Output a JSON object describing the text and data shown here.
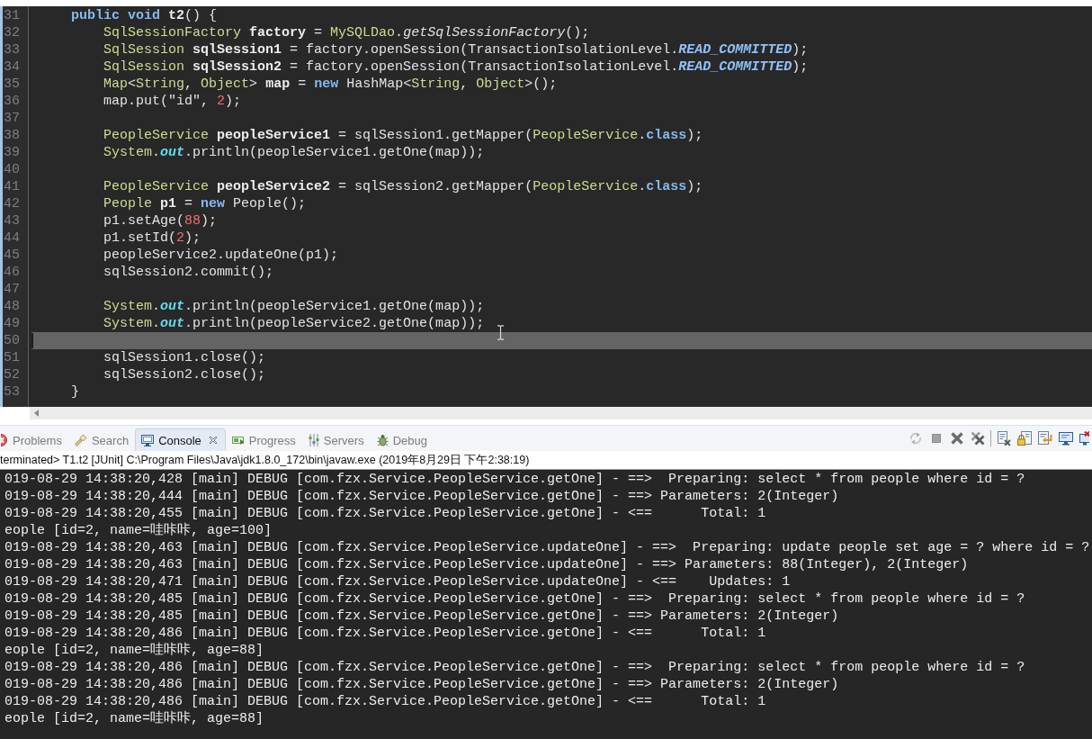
{
  "editor": {
    "lines": [
      {
        "number": "31",
        "current": false,
        "code": [
          {
            "kind": "keyword",
            "text": "    public void "
          },
          {
            "kind": "decl",
            "text": "t2"
          },
          {
            "kind": "plain",
            "text": "() {"
          }
        ]
      },
      {
        "number": "32",
        "current": false,
        "code": [
          {
            "kind": "type",
            "text": "        SqlSessionFactory "
          },
          {
            "kind": "decl",
            "text": "factory"
          },
          {
            "kind": "plain",
            "text": " = "
          },
          {
            "kind": "type",
            "text": "MySQLDao"
          },
          {
            "kind": "plain",
            "text": "."
          },
          {
            "kind": "static-method",
            "text": "getSqlSessionFactory"
          },
          {
            "kind": "plain",
            "text": "();"
          }
        ]
      },
      {
        "number": "33",
        "current": false,
        "code": [
          {
            "kind": "type",
            "text": "        SqlSession "
          },
          {
            "kind": "decl",
            "text": "sqlSession1"
          },
          {
            "kind": "plain",
            "text": " = factory.openSession(TransactionIsolationLevel."
          },
          {
            "kind": "constant",
            "text": "READ_COMMITTED"
          },
          {
            "kind": "plain",
            "text": ");"
          }
        ]
      },
      {
        "number": "34",
        "current": false,
        "code": [
          {
            "kind": "type",
            "text": "        SqlSession "
          },
          {
            "kind": "decl",
            "text": "sqlSession2"
          },
          {
            "kind": "plain",
            "text": " = factory.openSession(TransactionIsolationLevel."
          },
          {
            "kind": "constant",
            "text": "READ_COMMITTED"
          },
          {
            "kind": "plain",
            "text": ");"
          }
        ]
      },
      {
        "number": "35",
        "current": false,
        "code": [
          {
            "kind": "type",
            "text": "        Map"
          },
          {
            "kind": "plain",
            "text": "<"
          },
          {
            "kind": "type",
            "text": "String"
          },
          {
            "kind": "plain",
            "text": ", "
          },
          {
            "kind": "type",
            "text": "Object"
          },
          {
            "kind": "plain",
            "text": "> "
          },
          {
            "kind": "decl",
            "text": "map"
          },
          {
            "kind": "plain",
            "text": " = "
          },
          {
            "kind": "keyword",
            "text": "new"
          },
          {
            "kind": "plain",
            "text": " HashMap<"
          },
          {
            "kind": "type",
            "text": "String"
          },
          {
            "kind": "plain",
            "text": ", "
          },
          {
            "kind": "type",
            "text": "Object"
          },
          {
            "kind": "plain",
            "text": ">();"
          }
        ]
      },
      {
        "number": "36",
        "current": false,
        "code": [
          {
            "kind": "plain",
            "text": "        map.put(\"id\", "
          },
          {
            "kind": "number",
            "text": "2"
          },
          {
            "kind": "plain",
            "text": ");"
          }
        ]
      },
      {
        "number": "37",
        "current": false
      },
      {
        "number": "38",
        "current": false,
        "code": [
          {
            "kind": "type",
            "text": "        PeopleService "
          },
          {
            "kind": "decl",
            "text": "peopleService1"
          },
          {
            "kind": "plain",
            "text": " = sqlSession1.getMapper("
          },
          {
            "kind": "type",
            "text": "PeopleService"
          },
          {
            "kind": "plain",
            "text": "."
          },
          {
            "kind": "keyword",
            "text": "class"
          },
          {
            "kind": "plain",
            "text": ");"
          }
        ]
      },
      {
        "number": "39",
        "current": false,
        "code": [
          {
            "kind": "type",
            "text": "        System"
          },
          {
            "kind": "plain",
            "text": "."
          },
          {
            "kind": "field",
            "text": "out"
          },
          {
            "kind": "plain",
            "text": ".println(peopleService1.getOne(map));"
          }
        ]
      },
      {
        "number": "40",
        "current": false
      },
      {
        "number": "41",
        "current": false,
        "code": [
          {
            "kind": "type",
            "text": "        PeopleService "
          },
          {
            "kind": "decl",
            "text": "peopleService2"
          },
          {
            "kind": "plain",
            "text": " = sqlSession2.getMapper("
          },
          {
            "kind": "type",
            "text": "PeopleService"
          },
          {
            "kind": "plain",
            "text": "."
          },
          {
            "kind": "keyword",
            "text": "class"
          },
          {
            "kind": "plain",
            "text": ");"
          }
        ]
      },
      {
        "number": "42",
        "current": false,
        "code": [
          {
            "kind": "type",
            "text": "        People "
          },
          {
            "kind": "decl",
            "text": "p1"
          },
          {
            "kind": "plain",
            "text": " = "
          },
          {
            "kind": "keyword",
            "text": "new"
          },
          {
            "kind": "plain",
            "text": " People();"
          }
        ]
      },
      {
        "number": "43",
        "current": false,
        "code": [
          {
            "kind": "plain",
            "text": "        p1.setAge("
          },
          {
            "kind": "number",
            "text": "88"
          },
          {
            "kind": "plain",
            "text": ");"
          }
        ]
      },
      {
        "number": "44",
        "current": false,
        "code": [
          {
            "kind": "plain",
            "text": "        p1.setId("
          },
          {
            "kind": "number",
            "text": "2"
          },
          {
            "kind": "plain",
            "text": ");"
          }
        ]
      },
      {
        "number": "45",
        "current": false,
        "code": [
          {
            "kind": "plain",
            "text": "        peopleService2.updateOne(p1);"
          }
        ]
      },
      {
        "number": "46",
        "current": false,
        "code": [
          {
            "kind": "plain",
            "text": "        sqlSession2.commit();"
          }
        ]
      },
      {
        "number": "47",
        "current": false
      },
      {
        "number": "48",
        "current": false,
        "code": [
          {
            "kind": "type",
            "text": "        System"
          },
          {
            "kind": "plain",
            "text": "."
          },
          {
            "kind": "field",
            "text": "out"
          },
          {
            "kind": "plain",
            "text": ".println(peopleService1.getOne(map));"
          }
        ]
      },
      {
        "number": "49",
        "current": false,
        "code": [
          {
            "kind": "type",
            "text": "        System"
          },
          {
            "kind": "plain",
            "text": "."
          },
          {
            "kind": "field",
            "text": "out"
          },
          {
            "kind": "plain",
            "text": ".println(peopleService2.getOne(map));"
          }
        ]
      },
      {
        "number": "50",
        "current": true
      },
      {
        "number": "51",
        "current": false,
        "code": [
          {
            "kind": "plain",
            "text": "        sqlSession1.close();"
          }
        ]
      },
      {
        "number": "52",
        "current": false,
        "code": [
          {
            "kind": "plain",
            "text": "        sqlSession2.close();"
          }
        ]
      },
      {
        "number": "53",
        "current": false,
        "code": [
          {
            "kind": "plain",
            "text": "    }"
          }
        ]
      }
    ]
  },
  "panel": {
    "tabs": [
      {
        "label": "Problems",
        "kind": "problems",
        "selected": false
      },
      {
        "label": "Search",
        "kind": "search",
        "selected": false
      },
      {
        "label": "Console",
        "kind": "console",
        "selected": true
      },
      {
        "label": "Progress",
        "kind": "progress",
        "selected": false
      },
      {
        "label": "Servers",
        "kind": "servers",
        "selected": false
      },
      {
        "label": "Debug",
        "kind": "debug",
        "selected": false
      }
    ],
    "toolbar_groups": [
      {
        "buttons": [
          {
            "kind": "sync",
            "disabled": true
          },
          {
            "kind": "stop",
            "disabled": true
          },
          {
            "kind": "remove",
            "disabled": false
          },
          {
            "kind": "remove-all",
            "disabled": false
          }
        ]
      },
      {
        "buttons": [
          {
            "kind": "clear",
            "disabled": false
          },
          {
            "kind": "scroll-lock",
            "disabled": false
          },
          {
            "kind": "show-output",
            "disabled": false
          },
          {
            "kind": "display",
            "disabled": false
          },
          {
            "kind": "new-console",
            "disabled": false
          }
        ]
      }
    ],
    "status": "terminated> T1.t2 [JUnit] C:\\Program Files\\Java\\jdk1.8.0_172\\bin\\javaw.exe (2019年8月29日 下午2:38:19)",
    "console": {
      "lines": [
        "019-08-29 14:38:20,428 [main] DEBUG [com.fzx.Service.PeopleService.getOne] - ==>  Preparing: select * from people where id = ?",
        "019-08-29 14:38:20,444 [main] DEBUG [com.fzx.Service.PeopleService.getOne] - ==> Parameters: 2(Integer)",
        "019-08-29 14:38:20,455 [main] DEBUG [com.fzx.Service.PeopleService.getOne] - <==      Total: 1",
        "eople [id=2, name=哇咔咔, age=100]",
        "019-08-29 14:38:20,463 [main] DEBUG [com.fzx.Service.PeopleService.updateOne] - ==>  Preparing: update people set age = ? where id = ?",
        "019-08-29 14:38:20,463 [main] DEBUG [com.fzx.Service.PeopleService.updateOne] - ==> Parameters: 88(Integer), 2(Integer)",
        "019-08-29 14:38:20,471 [main] DEBUG [com.fzx.Service.PeopleService.updateOne] - <==    Updates: 1",
        "019-08-29 14:38:20,485 [main] DEBUG [com.fzx.Service.PeopleService.getOne] - ==>  Preparing: select * from people where id = ?",
        "019-08-29 14:38:20,485 [main] DEBUG [com.fzx.Service.PeopleService.getOne] - ==> Parameters: 2(Integer)",
        "019-08-29 14:38:20,486 [main] DEBUG [com.fzx.Service.PeopleService.getOne] - <==      Total: 1",
        "eople [id=2, name=哇咔咔, age=88]",
        "019-08-29 14:38:20,486 [main] DEBUG [com.fzx.Service.PeopleService.getOne] - ==>  Preparing: select * from people where id = ?",
        "019-08-29 14:38:20,486 [main] DEBUG [com.fzx.Service.PeopleService.getOne] - ==> Parameters: 2(Integer)",
        "019-08-29 14:38:20,486 [main] DEBUG [com.fzx.Service.PeopleService.getOne] - <==      Total: 1",
        "eople [id=2, name=哇咔咔, age=88]"
      ]
    }
  }
}
